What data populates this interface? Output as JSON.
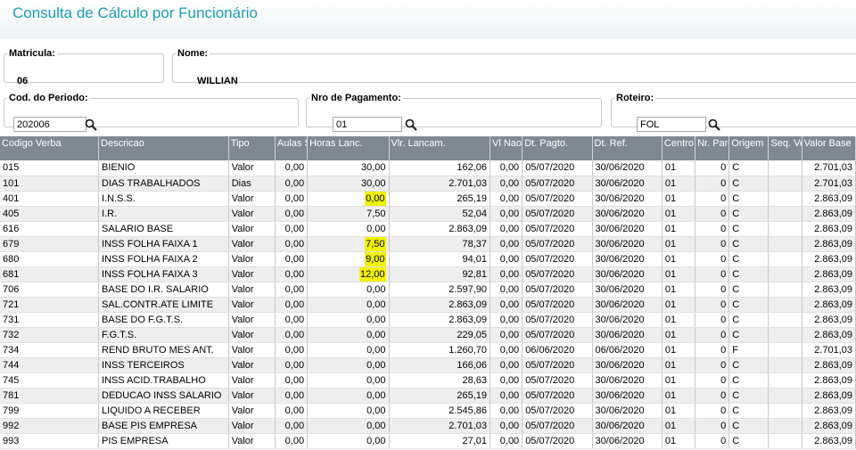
{
  "title": "Consulta de Cálculo por Funcionário",
  "matricula": {
    "label": "Matricula:",
    "value": "06"
  },
  "nome": {
    "label": "Nome:",
    "value": "WILLIAN"
  },
  "periodo": {
    "label": "Cod. do Periodo:",
    "value": "202006"
  },
  "pagamento": {
    "label": "Nro de Pagamento:",
    "value": "01"
  },
  "roteiro": {
    "label": "Roteiro:",
    "value": "FOL"
  },
  "icons": {
    "search": "search-icon"
  },
  "colors": {
    "title": "#1a9bb8",
    "header": "#808891",
    "highlight": "#f2f200"
  },
  "columns": [
    "Codigo Verba",
    "Descricao",
    "Tipo",
    "Aulas S",
    "Horas Lanc.",
    "Vlr. Lancam.",
    "Vl Nao",
    "Dt. Pagto.",
    "Dt. Ref.",
    "Centro",
    "Nr. Parc",
    "Origem",
    "Seq. Ve",
    "Valor Base"
  ],
  "rows": [
    [
      "015",
      "BIENIO",
      "Valor",
      "0,00",
      "30,00",
      "162,06",
      "0,00",
      "05/07/2020",
      "30/06/2020",
      "01",
      "0",
      "C",
      "",
      "2.701,03"
    ],
    [
      "101",
      "DIAS TRABALHADOS",
      "Dias",
      "0,00",
      "30,00",
      "2.701,03",
      "0,00",
      "05/07/2020",
      "30/06/2020",
      "01",
      "0",
      "C",
      "",
      "2.701,03"
    ],
    [
      "401",
      "I.N.S.S.",
      "Valor",
      "0,00",
      "0,00",
      "265,19",
      "0,00",
      "05/07/2020",
      "30/06/2020",
      "01",
      "0",
      "C",
      "",
      "2.863,09"
    ],
    [
      "405",
      "I.R.",
      "Valor",
      "0,00",
      "7,50",
      "52,04",
      "0,00",
      "05/07/2020",
      "30/06/2020",
      "01",
      "0",
      "C",
      "",
      "2.863,09"
    ],
    [
      "616",
      "SALARIO BASE",
      "Valor",
      "0,00",
      "0,00",
      "2.863,09",
      "0,00",
      "05/07/2020",
      "30/06/2020",
      "01",
      "0",
      "C",
      "",
      "2.863,09"
    ],
    [
      "679",
      "INSS FOLHA FAIXA 1",
      "Valor",
      "0,00",
      "7,50",
      "78,37",
      "0,00",
      "05/07/2020",
      "30/06/2020",
      "01",
      "0",
      "C",
      "",
      "2.863,09"
    ],
    [
      "680",
      "INSS FOLHA FAIXA 2",
      "Valor",
      "0,00",
      "9,00",
      "94,01",
      "0,00",
      "05/07/2020",
      "30/06/2020",
      "01",
      "0",
      "C",
      "",
      "2.863,09"
    ],
    [
      "681",
      "INSS FOLHA FAIXA 3",
      "Valor",
      "0,00",
      "12,00",
      "92,81",
      "0,00",
      "05/07/2020",
      "30/06/2020",
      "01",
      "0",
      "C",
      "",
      "2.863,09"
    ],
    [
      "706",
      "BASE DO I.R. SALARIO",
      "Valor",
      "0,00",
      "0,00",
      "2.597,90",
      "0,00",
      "05/07/2020",
      "30/06/2020",
      "01",
      "0",
      "C",
      "",
      "2.863,09"
    ],
    [
      "721",
      "SAL.CONTR.ATE LIMITE",
      "Valor",
      "0,00",
      "0,00",
      "2.863,09",
      "0,00",
      "05/07/2020",
      "30/06/2020",
      "01",
      "0",
      "C",
      "",
      "2.863,09"
    ],
    [
      "731",
      "BASE DO F.G.T.S.",
      "Valor",
      "0,00",
      "0,00",
      "2.863,09",
      "0,00",
      "05/07/2020",
      "30/06/2020",
      "01",
      "0",
      "C",
      "",
      "2.863,09"
    ],
    [
      "732",
      "F.G.T.S.",
      "Valor",
      "0,00",
      "0,00",
      "229,05",
      "0,00",
      "05/07/2020",
      "30/06/2020",
      "01",
      "0",
      "C",
      "",
      "2.863,09"
    ],
    [
      "734",
      "REND BRUTO MES ANT.",
      "Valor",
      "0,00",
      "0,00",
      "1.260,70",
      "0,00",
      "06/06/2020",
      "06/06/2020",
      "01",
      "0",
      "F",
      "",
      "2.701,03"
    ],
    [
      "744",
      "INSS TERCEIROS",
      "Valor",
      "0,00",
      "0,00",
      "166,06",
      "0,00",
      "05/07/2020",
      "30/06/2020",
      "01",
      "0",
      "C",
      "",
      "2.863,09"
    ],
    [
      "745",
      "INSS ACID.TRABALHO",
      "Valor",
      "0,00",
      "0,00",
      "28,63",
      "0,00",
      "05/07/2020",
      "30/06/2020",
      "01",
      "0",
      "C",
      "",
      "2.863,09"
    ],
    [
      "781",
      "DEDUCAO INSS SALARIO",
      "Valor",
      "0,00",
      "0,00",
      "265,19",
      "0,00",
      "05/07/2020",
      "30/06/2020",
      "01",
      "0",
      "C",
      "",
      "2.863,09"
    ],
    [
      "799",
      "LIQUIDO A RECEBER",
      "Valor",
      "0,00",
      "0,00",
      "2.545,86",
      "0,00",
      "05/07/2020",
      "30/06/2020",
      "01",
      "0",
      "C",
      "",
      "2.863,09"
    ],
    [
      "992",
      "BASE PIS EMPRESA",
      "Valor",
      "0,00",
      "0,00",
      "2.701,03",
      "0,00",
      "05/07/2020",
      "30/06/2020",
      "01",
      "0",
      "C",
      "",
      "2.863,09"
    ],
    [
      "993",
      "PIS EMPRESA",
      "Valor",
      "0,00",
      "0,00",
      "27,01",
      "0,00",
      "05/07/2020",
      "30/06/2020",
      "01",
      "0",
      "C",
      "",
      "2.863,09"
    ]
  ],
  "highlighted_hours_rows": [
    "401",
    "679",
    "680",
    "681"
  ]
}
